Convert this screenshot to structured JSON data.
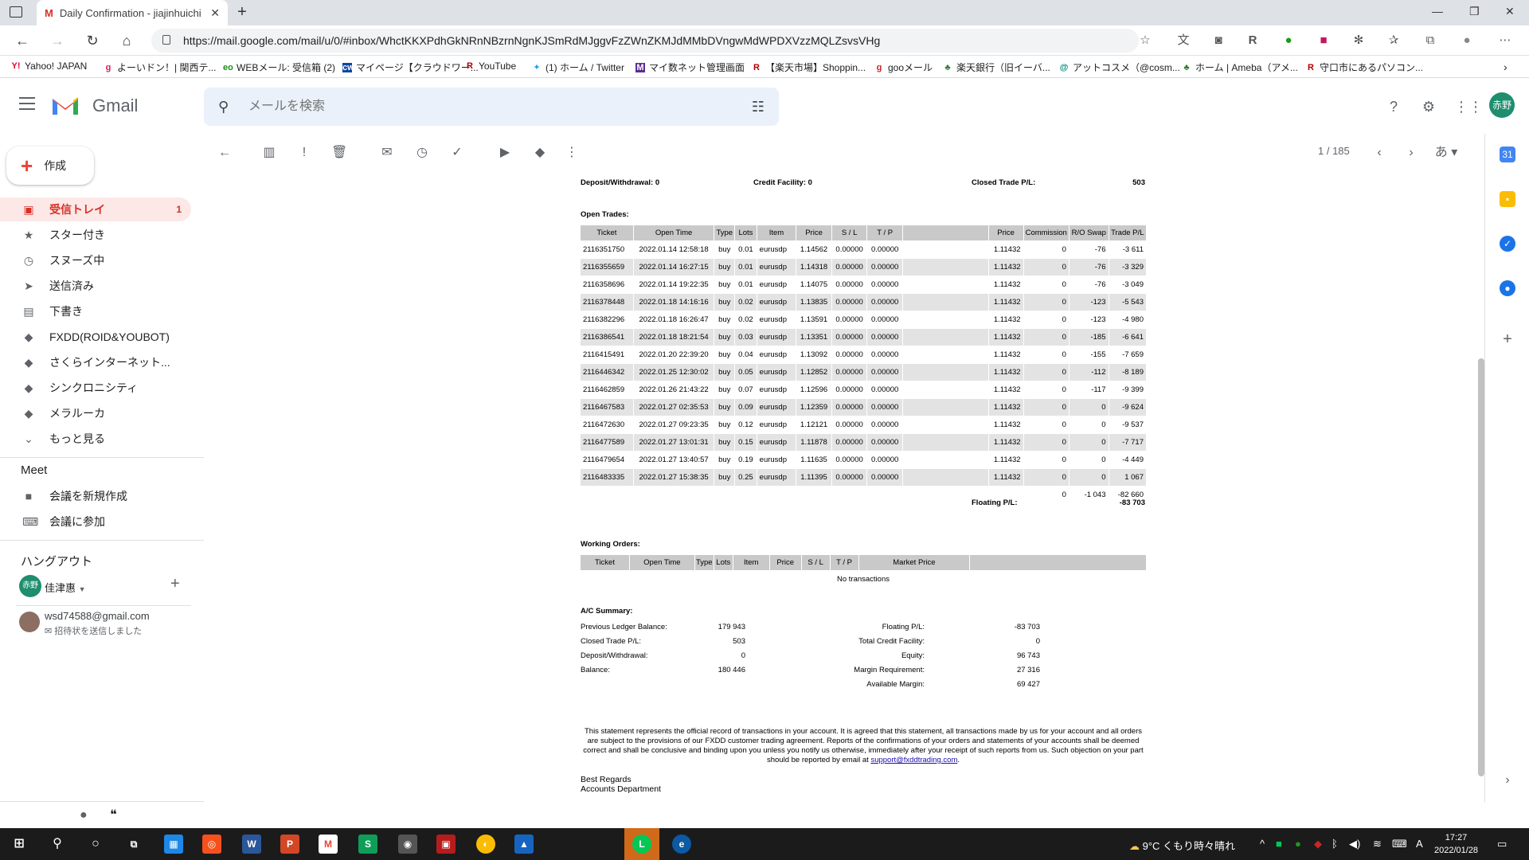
{
  "browser": {
    "tab_title": "Daily Confirmation - jiajinhuichi",
    "url": "https://mail.google.com/mail/u/0/#inbox/WhctKKXPdhGkNRnNBzrnNgnKJSmRdMJggvFzZWnZKMJdMMbDVngwMdWPDXVzzMQLZsvsVHg",
    "bookmarks": [
      "Yahoo! JAPAN",
      "よーいドン！| 関西テ...",
      "WEBメール: 受信箱 (2)",
      "マイページ【クラウドワー...",
      "YouTube",
      "(1) ホーム / Twitter",
      "マイ数ネット管理画面",
      "【楽天市場】Shoppin...",
      "gooメール",
      "楽天銀行（旧イーバ...",
      "アットコスメ（@cosm...",
      "ホーム | Ameba（アメ...",
      "守口市にあるパソコン..."
    ]
  },
  "gmail": {
    "app_name": "Gmail",
    "search_placeholder": "メールを検索",
    "avatar_text": "赤野",
    "compose_label": "作成",
    "nav": [
      {
        "label": "受信トレイ",
        "count": "1"
      },
      {
        "label": "スター付き"
      },
      {
        "label": "スヌーズ中"
      },
      {
        "label": "送信済み"
      },
      {
        "label": "下書き"
      },
      {
        "label": "FXDD(ROID&YOUBOT)"
      },
      {
        "label": "さくらインターネット..."
      },
      {
        "label": "シンクロニシティ"
      },
      {
        "label": "メラルーカ"
      },
      {
        "label": "もっと見る"
      }
    ],
    "meet_title": "Meet",
    "meet_items": [
      "会議を新規作成",
      "会議に参加"
    ],
    "hangout_title": "ハングアウト",
    "hangout_user": "佳津惠",
    "hangout_user_avatar": "赤野",
    "hangout_contact_email": "wsd74588@gmail.com",
    "hangout_contact_status": "招待状を送信しました",
    "pager": "1 / 185",
    "lang_label": "あ"
  },
  "statement": {
    "top_row": {
      "deposit_label": "Deposit/Withdrawal: 0",
      "credit_label": "Credit Facility: 0",
      "closed_label": "Closed Trade P/L:",
      "closed_value": "503"
    },
    "open_trades_title": "Open Trades:",
    "open_headers": [
      "Ticket",
      "Open Time",
      "Type",
      "Lots",
      "Item",
      "Price",
      "S / L",
      "T / P",
      "",
      "Price",
      "Commission",
      "R/O Swap",
      "Trade P/L"
    ],
    "open_rows": [
      [
        "2116351750",
        "2022.01.14 12:58:18",
        "buy",
        "0.01",
        "eurusdp",
        "1.14562",
        "0.00000",
        "0.00000",
        "",
        "1.11432",
        "0",
        "-76",
        "-3 611"
      ],
      [
        "2116355659",
        "2022.01.14 16:27:15",
        "buy",
        "0.01",
        "eurusdp",
        "1.14318",
        "0.00000",
        "0.00000",
        "",
        "1.11432",
        "0",
        "-76",
        "-3 329"
      ],
      [
        "2116358696",
        "2022.01.14 19:22:35",
        "buy",
        "0.01",
        "eurusdp",
        "1.14075",
        "0.00000",
        "0.00000",
        "",
        "1.11432",
        "0",
        "-76",
        "-3 049"
      ],
      [
        "2116378448",
        "2022.01.18 14:16:16",
        "buy",
        "0.02",
        "eurusdp",
        "1.13835",
        "0.00000",
        "0.00000",
        "",
        "1.11432",
        "0",
        "-123",
        "-5 543"
      ],
      [
        "2116382296",
        "2022.01.18 16:26:47",
        "buy",
        "0.02",
        "eurusdp",
        "1.13591",
        "0.00000",
        "0.00000",
        "",
        "1.11432",
        "0",
        "-123",
        "-4 980"
      ],
      [
        "2116386541",
        "2022.01.18 18:21:54",
        "buy",
        "0.03",
        "eurusdp",
        "1.13351",
        "0.00000",
        "0.00000",
        "",
        "1.11432",
        "0",
        "-185",
        "-6 641"
      ],
      [
        "2116415491",
        "2022.01.20 22:39:20",
        "buy",
        "0.04",
        "eurusdp",
        "1.13092",
        "0.00000",
        "0.00000",
        "",
        "1.11432",
        "0",
        "-155",
        "-7 659"
      ],
      [
        "2116446342",
        "2022.01.25 12:30:02",
        "buy",
        "0.05",
        "eurusdp",
        "1.12852",
        "0.00000",
        "0.00000",
        "",
        "1.11432",
        "0",
        "-112",
        "-8 189"
      ],
      [
        "2116462859",
        "2022.01.26 21:43:22",
        "buy",
        "0.07",
        "eurusdp",
        "1.12596",
        "0.00000",
        "0.00000",
        "",
        "1.11432",
        "0",
        "-117",
        "-9 399"
      ],
      [
        "2116467583",
        "2022.01.27 02:35:53",
        "buy",
        "0.09",
        "eurusdp",
        "1.12359",
        "0.00000",
        "0.00000",
        "",
        "1.11432",
        "0",
        "0",
        "-9 624"
      ],
      [
        "2116472630",
        "2022.01.27 09:23:35",
        "buy",
        "0.12",
        "eurusdp",
        "1.12121",
        "0.00000",
        "0.00000",
        "",
        "1.11432",
        "0",
        "0",
        "-9 537"
      ],
      [
        "2116477589",
        "2022.01.27 13:01:31",
        "buy",
        "0.15",
        "eurusdp",
        "1.11878",
        "0.00000",
        "0.00000",
        "",
        "1.11432",
        "0",
        "0",
        "-7 717"
      ],
      [
        "2116479654",
        "2022.01.27 13:40:57",
        "buy",
        "0.19",
        "eurusdp",
        "1.11635",
        "0.00000",
        "0.00000",
        "",
        "1.11432",
        "0",
        "0",
        "-4 449"
      ],
      [
        "2116483335",
        "2022.01.27 15:38:35",
        "buy",
        "0.25",
        "eurusdp",
        "1.11395",
        "0.00000",
        "0.00000",
        "",
        "1.11432",
        "0",
        "0",
        "1 067"
      ]
    ],
    "totals": {
      "commission": "0",
      "swap": "-1 043",
      "trade_pl": "-82 660"
    },
    "floating_label": "Floating P/L:",
    "floating_value": "-83 703",
    "working_title": "Working Orders:",
    "working_headers": [
      "Ticket",
      "Open Time",
      "Type",
      "Lots",
      "Item",
      "Price",
      "S / L",
      "T / P",
      "Market Price",
      ""
    ],
    "no_transactions": "No transactions",
    "summary_title": "A/C Summary:",
    "summary_left": [
      {
        "label": "Previous Ledger Balance:",
        "value": "179 943"
      },
      {
        "label": "Closed Trade P/L:",
        "value": "503"
      },
      {
        "label": "Deposit/Withdrawal:",
        "value": "0"
      },
      {
        "label": "Balance:",
        "value": "180 446"
      }
    ],
    "summary_right": [
      {
        "label": "Floating P/L:",
        "value": "-83 703"
      },
      {
        "label": "Total Credit Facility:",
        "value": "0"
      },
      {
        "label": "Equity:",
        "value": "96 743"
      },
      {
        "label": "Margin Requirement:",
        "value": "27 316"
      },
      {
        "label": "Available Margin:",
        "value": "69 427"
      }
    ],
    "legal_text": "This statement represents the official record of transactions in your account. It is agreed that this statement, all transactions made by us for your account and all orders are subject to the provisions of our FXDD customer trading agreement. Reports of the confirmations of your orders and statements of your accounts shall be deemed correct and shall be conclusive and binding upon you unless you notify us otherwise, immediately after your receipt of such reports from us. Such objection on your part should be reported by email at",
    "legal_email": "support@fxddtrading.com",
    "legal_end": ".",
    "regards_1": "Best Regards",
    "regards_2": "Accounts Department"
  },
  "taskbar": {
    "weather": "9°C くもり時々晴れ",
    "time": "17:27",
    "date": "2022/01/28",
    "ime": "A"
  },
  "colors": {
    "inbox_active_bg": "#fce8e6",
    "inbox_active_text": "#d93025",
    "table_header": "#c9c9c9",
    "table_alt_row": "#e3e3e3",
    "avatar": "#1e8e6e"
  }
}
